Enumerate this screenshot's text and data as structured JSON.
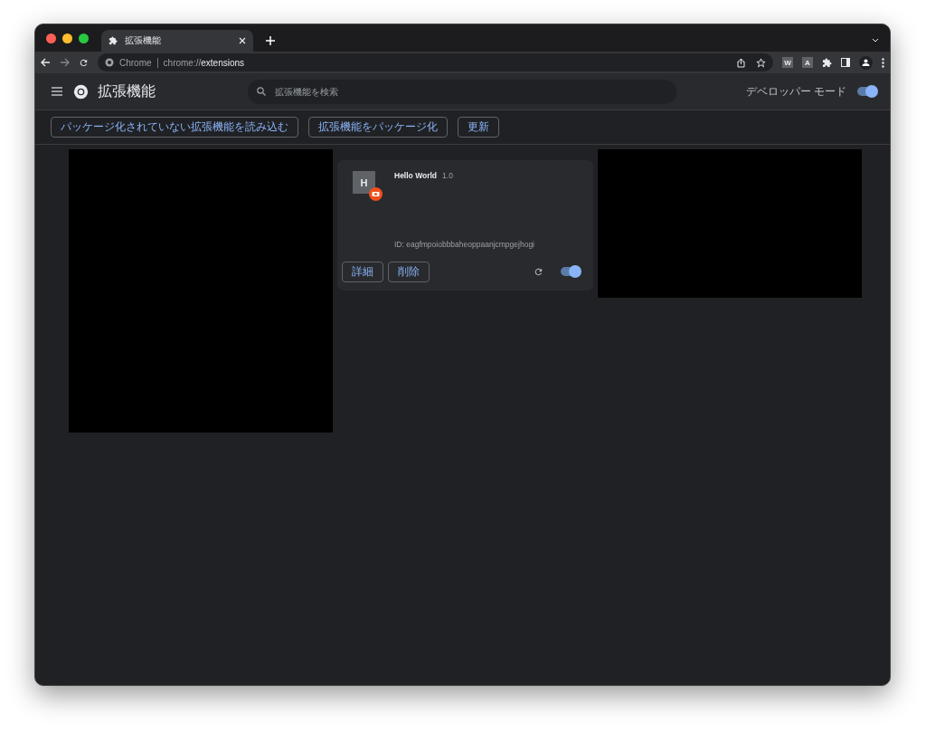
{
  "tab": {
    "title": "拡張機能"
  },
  "address_bar": {
    "site_label": "Chrome",
    "url_prefix": "chrome://",
    "url_path": "extensions"
  },
  "toolbar_extensions": [
    "W",
    "A"
  ],
  "header": {
    "title": "拡張機能",
    "search": {
      "placeholder": "拡張機能を検索"
    },
    "developer_mode": {
      "label": "デベロッパー モード",
      "on": true
    }
  },
  "actions": [
    "パッケージ化されていない拡張機能を読み込む",
    "拡張機能をパッケージ化",
    "更新"
  ],
  "extensions": [
    {
      "icon_letter": "H",
      "name": "Hello World",
      "version": "1.0",
      "id": "ID: eagfmpoiobbbaheoppaanjcmpgejhogi",
      "buttons": [
        "詳細",
        "削除"
      ],
      "on": true
    }
  ]
}
